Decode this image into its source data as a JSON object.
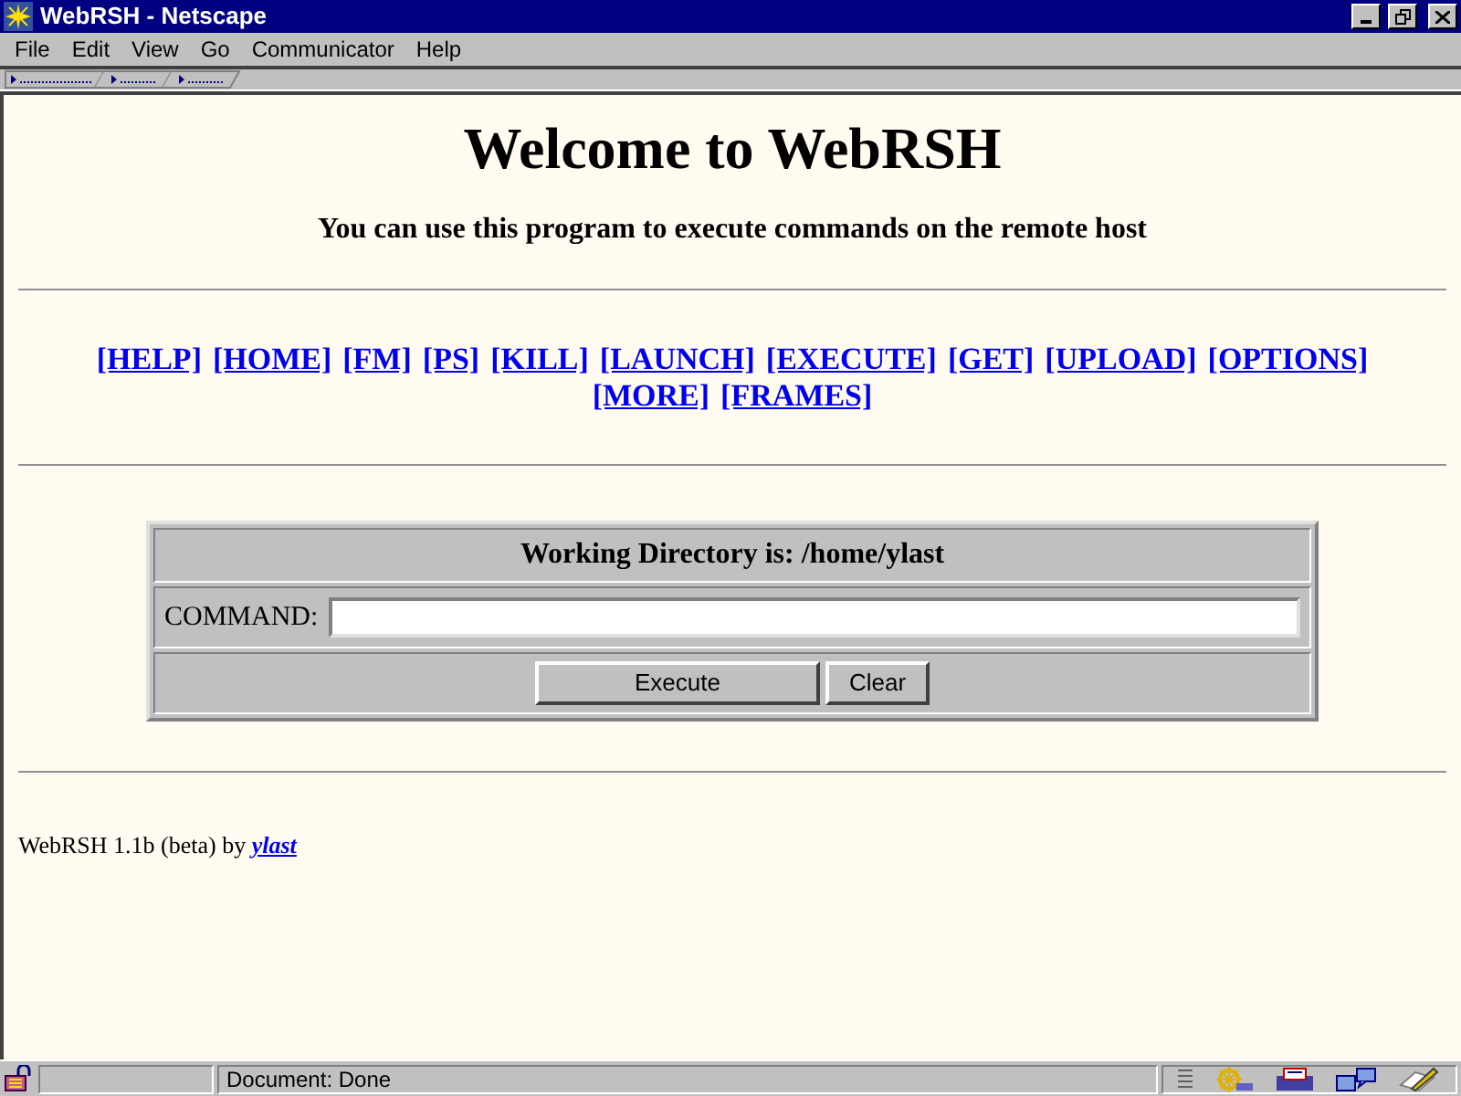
{
  "window": {
    "title": "WebRSH - Netscape"
  },
  "menu": [
    "File",
    "Edit",
    "View",
    "Go",
    "Communicator",
    "Help"
  ],
  "page": {
    "heading": "Welcome to WebRSH",
    "subtitle": "You can use this program to execute commands on the remote host",
    "links": [
      "[HELP]",
      "[HOME]",
      "[FM]",
      "[PS]",
      "[KILL]",
      "[LAUNCH]",
      "[EXECUTE]",
      "[GET]",
      "[UPLOAD]",
      "[OPTIONS]",
      "[MORE]",
      "[FRAMES]"
    ],
    "form": {
      "header": "Working Directory is: /home/ylast",
      "command_label": "COMMAND:",
      "buttons": [
        "Execute",
        "Clear"
      ]
    },
    "footer": {
      "text": "WebRSH 1.1b (beta) by",
      "author": "ylast"
    }
  },
  "status_bar": {
    "text": "Document: Done"
  }
}
